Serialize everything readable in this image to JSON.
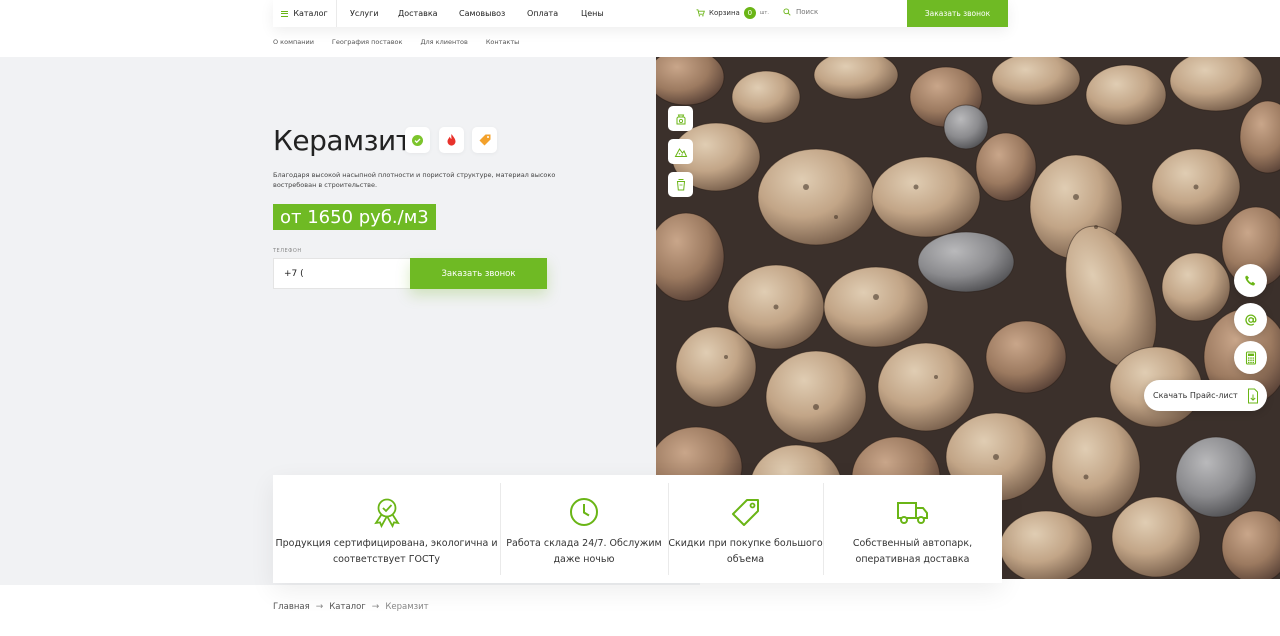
{
  "nav": {
    "catalog": "Каталог",
    "links": [
      "Услуги",
      "Доставка",
      "Самовывоз",
      "Оплата",
      "Цены"
    ],
    "cart_label": "Корзина",
    "cart_count": "0",
    "cart_unit": "шт.",
    "search_placeholder": "Поиск",
    "call_button": "Заказать звонок"
  },
  "subnav": [
    "О компании",
    "География поставок",
    "Для клиентов",
    "Контакты"
  ],
  "hero": {
    "title": "Керамзит",
    "feature_icons": [
      "check-badge-icon",
      "fire-drop-icon",
      "price-tag-icon"
    ],
    "description": "Благодаря высокой насыпной плотности и пористой структуре, материал высоко востребован в строительстве.",
    "price": "от 1650 руб./м3",
    "phone_label": "Телефон",
    "phone_value": "+7 (",
    "call_button": "Заказать звонок",
    "photo_icons": [
      "bag-icon",
      "pile-icon",
      "bucket-icon"
    ]
  },
  "floating": {
    "icons": [
      "phone-icon",
      "at-icon",
      "calculator-icon"
    ],
    "price_list": "Скачать Прайс-лист"
  },
  "advantages": [
    {
      "icon": "certificate-icon",
      "text": "Продукция сертифицирована, экологична и соответствует ГОСТу"
    },
    {
      "icon": "clock-icon",
      "text": "Работа склада 24/7. Обслужим даже ночью"
    },
    {
      "icon": "tag-icon",
      "text": "Скидки при покупке большого объема"
    },
    {
      "icon": "truck-icon",
      "text": "Собственный автопарк, оперативная доставка"
    }
  ],
  "breadcrumbs": [
    "Главная",
    "Каталог",
    "Керамзит"
  ],
  "colors": {
    "accent": "#6fba24",
    "hero_bg": "#f1f2f4"
  }
}
